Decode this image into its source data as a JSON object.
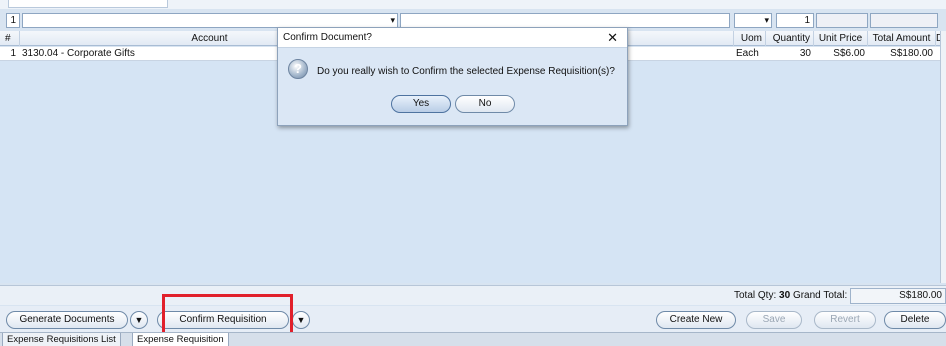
{
  "filter": {
    "row_number": "1",
    "quantity": "1"
  },
  "columns": [
    "#",
    "Account",
    "Uom",
    "Quantity",
    "Unit Price",
    "Total Amount",
    "D"
  ],
  "rows": [
    {
      "num": "1",
      "account": "3130.04 - Corporate Gifts",
      "uom": "Each",
      "quantity": "30",
      "unit_price": "S$6.00",
      "total_amount": "S$180.00"
    }
  ],
  "totals": {
    "label_prefix": "Total ",
    "qty_label": "Qty",
    "qty_value": "30",
    "grand_label": "Grand Total:",
    "grand_value": "S$180.00"
  },
  "actions": {
    "generate": "Generate Documents",
    "confirm": "Confirm Requisition",
    "create_new": "Create New",
    "save": "Save",
    "revert": "Revert",
    "delete": "Delete"
  },
  "tabs": [
    "Expense Requisitions List",
    "Expense Requisition"
  ],
  "dialog": {
    "title": "Confirm Document?",
    "message": "Do you really wish to Confirm the selected Expense Requisition(s)?",
    "yes": "Yes",
    "no": "No"
  },
  "icons": {
    "dialog": "question-icon",
    "close": "close-icon",
    "dropdown": "chevron-down-icon"
  },
  "colors": {
    "highlight": "#e1202b",
    "grid_bg": "#d5e4f4"
  }
}
